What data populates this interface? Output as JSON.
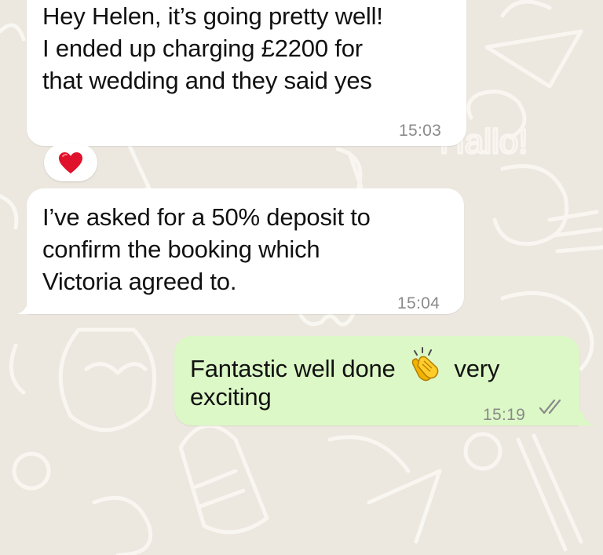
{
  "chat": {
    "messages": [
      {
        "direction": "incoming",
        "text": "Hey Helen, it’s going pretty well!\nI ended up charging £2200 for\nthat wedding and they said yes",
        "time": "15:03",
        "reaction": "heart-emoji"
      },
      {
        "direction": "incoming",
        "text": "I’ve asked for a 50% deposit to\nconfirm the booking which\nVictoria agreed to.",
        "time": "15:04"
      },
      {
        "direction": "outgoing",
        "text_before_emoji": "Fantastic well done",
        "emoji": "clapping-hands-emoji",
        "text_after_emoji": "very",
        "text_line2": "exciting",
        "time": "15:19",
        "status": "read-double-tick"
      }
    ]
  },
  "colors": {
    "wallpaper": "#ece7df",
    "incoming_bubble": "#ffffff",
    "outgoing_bubble": "#dcf8c6",
    "timestamp": "#8a8a8a",
    "heart": "#e0112b"
  }
}
